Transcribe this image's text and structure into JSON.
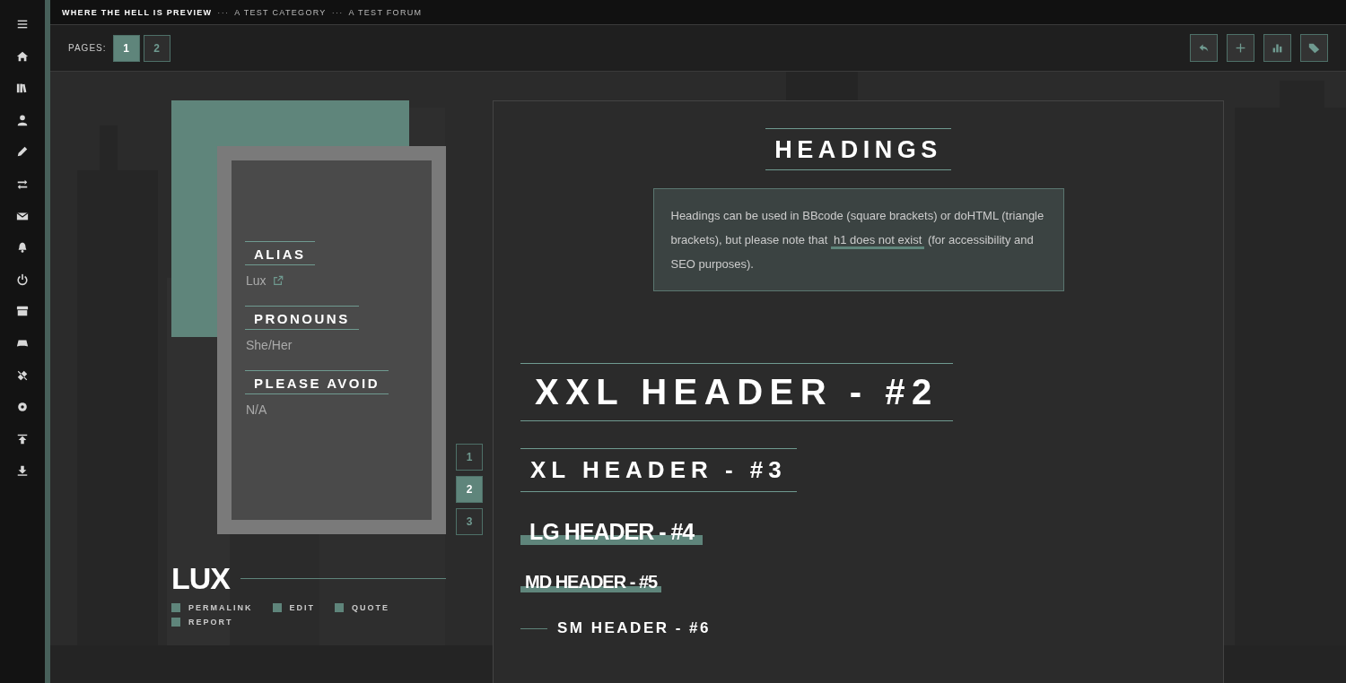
{
  "breadcrumb": {
    "separator": "···",
    "items": [
      {
        "label": "WHERE THE HELL IS PREVIEW",
        "selected": true
      },
      {
        "label": "A TEST CATEGORY",
        "selected": false
      },
      {
        "label": "A TEST FORUM",
        "selected": false
      }
    ]
  },
  "pagination": {
    "label": "PAGES:",
    "pages": [
      {
        "label": "1",
        "selected": true
      },
      {
        "label": "2",
        "selected": false
      }
    ]
  },
  "profile": {
    "fields": [
      {
        "label": "ALIAS",
        "value": "Lux",
        "link": true
      },
      {
        "label": "PRONOUNS",
        "value": "She/Her",
        "link": false
      },
      {
        "label": "PLEASE AVOID",
        "value": "N/A",
        "link": false
      }
    ],
    "card_pages": [
      {
        "label": "1",
        "selected": false
      },
      {
        "label": "2",
        "selected": true
      },
      {
        "label": "3",
        "selected": false
      }
    ],
    "name": "LUX",
    "actions": [
      "PERMALINK",
      "EDIT",
      "QUOTE",
      "REPORT"
    ]
  },
  "post": {
    "title": "HEADINGS",
    "note": {
      "before": "Headings can be used in BBcode (square brackets) or doHTML (triangle brackets), but please note that",
      "highlight": "h1 does not exist",
      "after": "(for accessibility and SEO purposes)."
    },
    "headers": [
      {
        "text": "XXL HEADER - #2",
        "kind": "xxl"
      },
      {
        "text": "XL HEADER - #3",
        "kind": "xl"
      },
      {
        "text": "LG HEADER - #4",
        "kind": "lg"
      },
      {
        "text": "MD HEADER - #5",
        "kind": "md"
      },
      {
        "text": "SM HEADER - #6",
        "kind": "sm"
      }
    ]
  }
}
